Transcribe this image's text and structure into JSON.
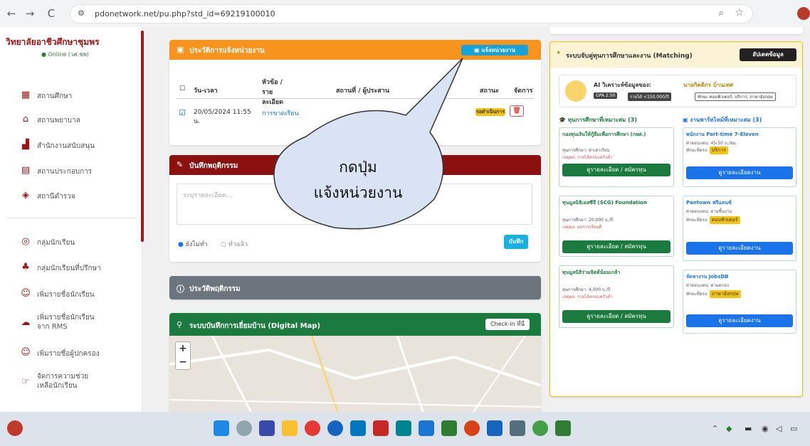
{
  "browser": {
    "url": "pdonetwork.net/pu.php?std_id=69219100010",
    "nav": {
      "back": "←",
      "forward": "→",
      "reload": "C"
    }
  },
  "sidebar": {
    "college": "วิทยาลัยอาชีวศึกษาชุมพร",
    "online": "● Online (วศ.ชพ)",
    "items": [
      {
        "label": "สถานศึกษา",
        "icon": "building-icon"
      },
      {
        "label": "สถานพยาบาล",
        "icon": "hospital-icon"
      },
      {
        "label": "สำนักงานสนับสนุน",
        "icon": "chart-icon"
      },
      {
        "label": "สถานประกอบการ",
        "icon": "office-icon"
      },
      {
        "label": "สถานีตำรวจ",
        "icon": "shield-icon"
      },
      {
        "label": "กลุ่มนักเรียน",
        "icon": "circle-icon"
      },
      {
        "label": "กลุ่มนักเรียนที่ปรึกษา",
        "icon": "users-icon"
      },
      {
        "label": "เพิ่มรายชื่อนักเรียน",
        "icon": "user-add-icon"
      },
      {
        "label": "เพิ่มรายชื่อนักเรียนจาก RMS",
        "icon": "cloud-icon"
      },
      {
        "label": "เพิ่มรายชื่อผู้ปกครอง",
        "icon": "user-icon"
      },
      {
        "label": "จัดการความช่วยเหลือนักเรียน",
        "icon": "hand-icon"
      }
    ]
  },
  "activity": {
    "title": "ประวัติการแจ้งหน่วยงาน",
    "notify_button": "แจ้งหน่วยงาน",
    "columns": [
      "วัน-เวลา",
      "หัวข้อ / รายละเอียด",
      "สถานที่ / ผู้ประสาน",
      "สถานะ",
      "จัดการ"
    ],
    "row": {
      "datetime": "20/05/2024 11:55 น.",
      "topic": "การขาดเรียน",
      "status": "รอดำเนินการ"
    }
  },
  "behavior": {
    "title": "บันทึกพฤติกรรม",
    "placeholder": "ระบุรายละเอียด...",
    "radio1": "ยังไม่ทำ",
    "radio2": "ทำแล้ว",
    "save": "บันทึก"
  },
  "history": {
    "title": "ประวัติพฤติกรรม"
  },
  "map": {
    "title": "ระบบบันทึกการเยี่ยมบ้าน (Digital Map)",
    "checkin": "Check-in ที่นี่",
    "zoom_in": "+",
    "zoom_out": "−"
  },
  "bubble": {
    "line1": "กดปุ่ม",
    "line2": "แจ้งหน่วยงาน"
  },
  "matching": {
    "title": "ระบบจับคู่ทุนการศึกษาและงาน (Matching)",
    "update_button": "อัปเดตข้อมูล",
    "ai_label": "AI วิเคราะห์ข้อมูลของ:",
    "ai_name": "นายกิตติกร บ้านเทศ",
    "tags": [
      "GPA 2.50",
      "รายได้ <150,000/ปี",
      "ทักษะ คอมพิวเตอร์, บริการ, ภาษาอังกฤษ"
    ],
    "scholarship_title": "ทุนการศึกษาที่เหมาะสม (3)",
    "job_title": "งานพาร์ทไทม์ที่เหมาะสม (3)",
    "scholarships": [
      {
        "name": "กองทุนเงินให้กู้ยืมเพื่อการศึกษา (กยศ.)",
        "line1": "ทุนการศึกษา: ค่าเล่าเรียน",
        "line2": "เหตุผล: รายได้ครอบครัวต่ำ",
        "button": "ดูรายละเอียด / สมัครทุน"
      },
      {
        "name": "ทุนมูลนิธิเอสซีจี (SCG) Foundation",
        "line1": "ทุนการศึกษา: 20,000 บ./ปี",
        "line2": "เหตุผล: ผลการเรียนดี",
        "button": "ดูรายละเอียด / สมัครทุน"
      },
      {
        "name": "ทุนมูลนิธิร่วมจิตต์น้อมเกล้า",
        "line1": "ทุนการศึกษา: 4,000 บ./ปี",
        "line2": "เหตุผล: รายได้ครอบครัวต่ำ",
        "button": "ดูรายละเอียด / สมัครทุน"
      }
    ],
    "jobs": [
      {
        "name": "พนักงาน Part-time 7-Eleven",
        "line1": "ค่าตอบแทน: 45-50 บ./ชม.",
        "line2": "ทักษะที่ตรง:",
        "tag": "บริการ",
        "button": "ดูรายละเอียดงาน"
      },
      {
        "name": "Pantown ฟรีแลนซ์",
        "line1": "ค่าตอบแทน: ตามชิ้นงาน",
        "line2": "ทักษะที่ตรง:",
        "tag": "คอมพิวเตอร์",
        "button": "ดูรายละเอียดงาน"
      },
      {
        "name": "จัดหางาน JobsDB",
        "line1": "ค่าตอบแทน: ตามตกลง",
        "line2": "ทักษะที่ตรง:",
        "tag": "ภาษาอังกฤษ",
        "button": "ดูรายละเอียดงาน"
      }
    ]
  },
  "colors": {
    "orange": "#f7941d",
    "darkred": "#8b1010",
    "gray": "#6c757d",
    "green": "#1b7a3e",
    "blue": "#1a73e8",
    "cyan": "#17a2d8",
    "yellow": "#f5c20f"
  }
}
